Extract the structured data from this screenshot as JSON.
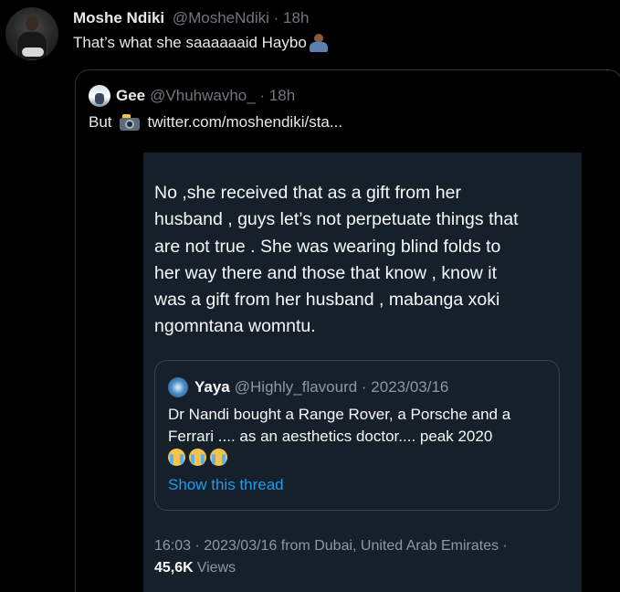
{
  "tweet": {
    "author_name": "Moshe Ndiki",
    "handle_time": "@MosheNdiki · 18h",
    "text": "That’s what she saaaaaaid Haybo",
    "emoji_icon": "person-shrugging-icon"
  },
  "quoted_tweet": {
    "author_name": "Gee",
    "handle_time": "@Vhuhwavho_ · 18h",
    "text_prefix": "But",
    "camera_icon": "camera-flash-icon",
    "link": "twitter.com/moshendiki/sta..."
  },
  "screenshot": {
    "text": "No ,she received that as a gift from her\nhusband , guys let’s not perpetuate things that\nare not true . She was wearing blind folds to\nher way there and those that know , know it\nwas a gift from her husband , mabanga xoki\nngomntana womntu.",
    "inner_quote": {
      "author_name": "Yaya",
      "handle_date": "@Highly_flavourd · 2023/03/16",
      "text": "Dr Nandi bought a Range Rover, a Porsche and a Ferrari .... as an aesthetics doctor.... peak 2020",
      "emoji_icon": "loudly-crying-face-icon",
      "show_thread": "Show this thread"
    },
    "footer": "16:03 · 2023/03/16 from Dubai, United Arab Emirates ·",
    "views_count": "45,6K",
    "views_label": "Views"
  },
  "colors": {
    "background": "#000000",
    "text_primary": "#e7e9ea",
    "text_secondary": "#71767b",
    "accent": "#1d9bf0",
    "dim_background": "#15202b"
  }
}
